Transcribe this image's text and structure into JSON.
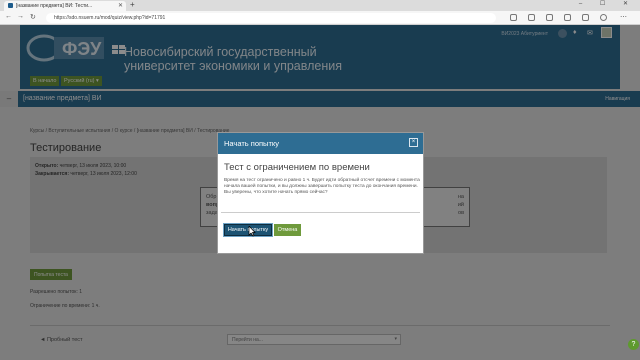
{
  "browser": {
    "tab_title": "[название предмета] ВИ: Тести...",
    "tab_close": "✕",
    "new_tab": "+",
    "url": "https://sdo.nsuem.ru/mod/quiz/view.php?id=71791",
    "window_controls": "–  ☐  ✕"
  },
  "header": {
    "university_line1": "Новосибирский государственный",
    "university_line2": "университет экономики и управления",
    "logo_text": "ФЭУ",
    "user_name": "ВИ2023 Абитуриент",
    "home_button": "В начало",
    "lang_button": "Русский (ru) ▾"
  },
  "course_bar": {
    "title": "[название предмета] ВИ",
    "navigation": "Навигация",
    "toggle": "–"
  },
  "breadcrumbs": "Курсы  /  Вступительные испытания  /  О курсе  /  [название предмета] ВИ  /  Тестирование",
  "page": {
    "title": "Тестирование",
    "opened_label": "Открыто:",
    "opened_value": "четверг, 13 июля 2023, 10:00",
    "closes_label": "Закрывается:",
    "closes_value": "четверг, 13 июля 2023, 12:00",
    "inner_left": "Обр",
    "inner_left2": "вопр",
    "inner_left3": "задани",
    "inner_right": "на",
    "inner_right2": "ий",
    "inner_right3": "ов",
    "start_button": "Попытка теста",
    "attempts_allowed": "Разрешено попыток: 1",
    "time_limit": "Ограничение по времени: 1 ч.",
    "prev_link": "◄ Пробный тест",
    "jump_placeholder": "Перейти на...",
    "jump_chevron": "▾",
    "help": "?"
  },
  "modal": {
    "title": "Начать попытку",
    "close": "×",
    "subtitle": "Тест с ограничением по времени",
    "message": "Время на тест ограничено и равно 1 ч. Будет идти обратный отсчет времени с момента начала вашей попытки, и вы должны завершить попытку теста до окончания времени. Вы уверены, что хотите начать прямо сейчас?",
    "start_button": "Начать попытку",
    "cancel_button": "Отмена"
  },
  "colors": {
    "brand_blue": "#2e6d93",
    "button_green": "#6f9a3c",
    "primary_dark": "#1c5373"
  }
}
